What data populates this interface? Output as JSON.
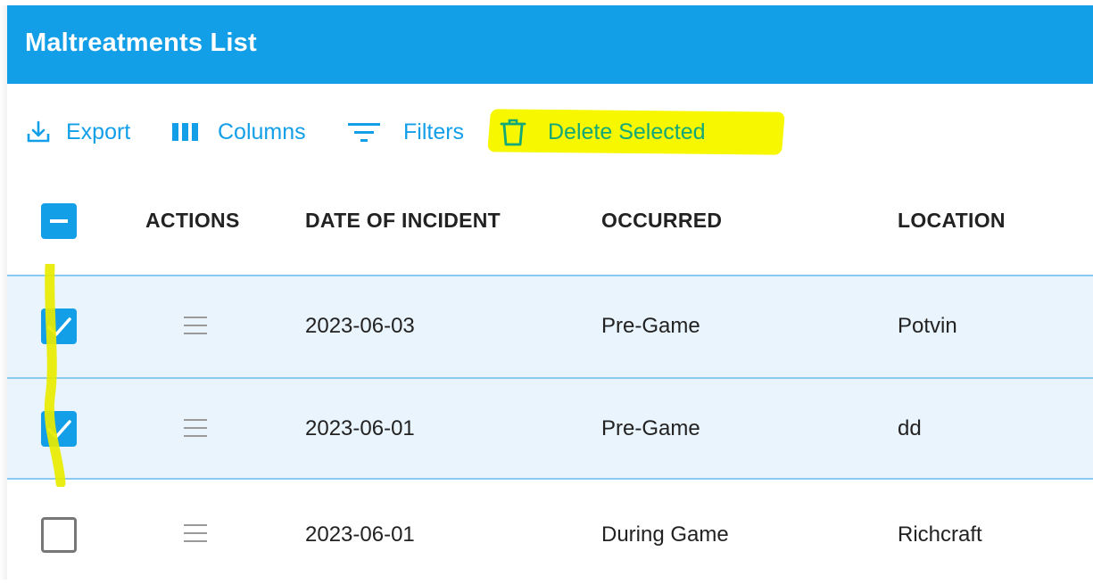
{
  "header": {
    "title": "Maltreatments List"
  },
  "toolbar": {
    "export_label": "Export",
    "columns_label": "Columns",
    "filters_label": "Filters",
    "delete_label": "Delete Selected"
  },
  "table": {
    "select_all_state": "indeterminate",
    "columns": [
      "ACTIONS",
      "DATE OF INCIDENT",
      "OCCURRED",
      "LOCATION"
    ],
    "rows": [
      {
        "selected": true,
        "date": "2023-06-03",
        "occurred": "Pre-Game",
        "location": "Potvin"
      },
      {
        "selected": true,
        "date": "2023-06-01",
        "occurred": "Pre-Game",
        "location": "dd"
      },
      {
        "selected": false,
        "date": "2023-06-01",
        "occurred": "During Game",
        "location": "Richcraft"
      }
    ]
  },
  "icons": {
    "export": "download-icon",
    "columns": "columns-icon",
    "filters": "filter-icon",
    "delete": "trash-icon",
    "row_action": "menu-icon"
  },
  "colors": {
    "accent": "#139fe8",
    "highlight": "#f7f700",
    "selected_row": "#eaf4fc"
  }
}
